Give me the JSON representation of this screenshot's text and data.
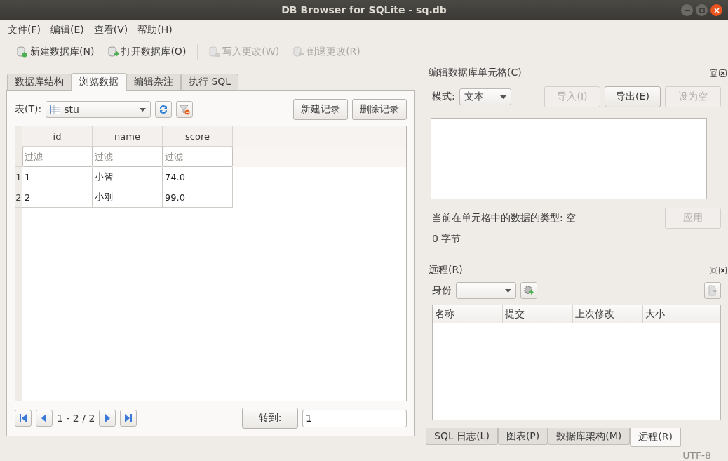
{
  "window": {
    "title": "DB Browser for SQLite - sq.db"
  },
  "menu": [
    "文件(F)",
    "编辑(E)",
    "查看(V)",
    "帮助(H)"
  ],
  "toolbar": [
    {
      "kind": "new",
      "label": "新建数据库(N)",
      "disabled": false
    },
    {
      "kind": "open",
      "label": "打开数据库(O)",
      "disabled": false
    },
    {
      "kind": "write",
      "label": "写入更改(W)",
      "disabled": true
    },
    {
      "kind": "revert",
      "label": "倒退更改(R)",
      "disabled": true
    }
  ],
  "main_tabs": [
    {
      "label": "数据库结构",
      "selected": false
    },
    {
      "label": "浏览数据",
      "selected": true
    },
    {
      "label": "编辑杂注",
      "selected": false
    },
    {
      "label": "执行 SQL",
      "selected": false
    }
  ],
  "browse": {
    "table_label": "表(T):",
    "table": "stu",
    "buttons": [
      "新建记录",
      "删除记录"
    ],
    "columns": [
      "id",
      "name",
      "score"
    ],
    "filter_placeholders": [
      "过滤",
      "过滤",
      "过滤"
    ],
    "rows": [
      {
        "number": "1",
        "cells": [
          "1",
          "小智",
          "74.0"
        ]
      },
      {
        "number": "2",
        "cells": [
          "2",
          "小刚",
          "99.0"
        ]
      }
    ],
    "pager": "1 - 2 / 2",
    "goto_button": "转到:",
    "goto_value": "1"
  },
  "edit_cell": {
    "title": "编辑数据库单元格(C)",
    "mode_label": "模式:",
    "mode": "文本",
    "buttons": [
      {
        "label": "导入(I)",
        "disabled": true
      },
      {
        "label": "导出(E)",
        "disabled": false
      },
      {
        "label": "设为空",
        "disabled": true
      }
    ],
    "type_info": "当前在单元格中的数据的类型: 空",
    "size_info": "0 字节",
    "apply": {
      "label": "应用",
      "disabled": true
    }
  },
  "remote": {
    "title": "远程(R)",
    "identity_label": "身份",
    "columns": [
      "名称",
      "提交",
      "上次修改",
      "大小"
    ]
  },
  "dock_tabs": [
    {
      "label": "SQL 日志(L)",
      "selected": false
    },
    {
      "label": "图表(P)",
      "selected": false
    },
    {
      "label": "数据库架构(M)",
      "selected": false
    },
    {
      "label": "远程(R)",
      "selected": true
    }
  ],
  "status_bar": {
    "encoding": "UTF-8"
  }
}
